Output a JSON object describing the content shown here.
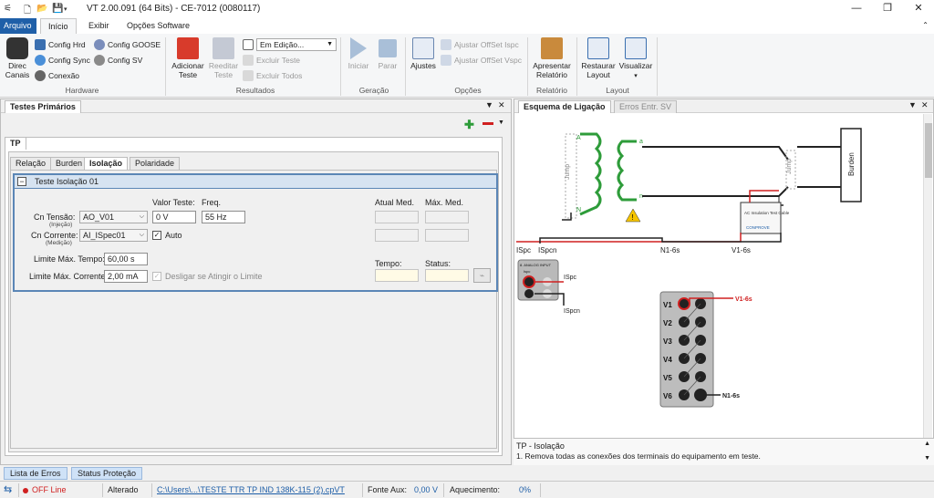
{
  "titlebar": {
    "title": "VT 2.00.091 (64 Bits) - CE-7012 (0080117)"
  },
  "tabs": {
    "file": "Arquivo",
    "inicio": "Início",
    "exibir": "Exibir",
    "opcoes": "Opções Software"
  },
  "ribbon": {
    "direc": "Direc Canais",
    "config_hrd": "Config Hrd",
    "config_sync": "Config Sync",
    "conexao": "Conexão",
    "config_goose": "Config GOOSE",
    "config_sv": "Config SV",
    "adicionar_teste": "Adicionar Teste",
    "reeditar_teste": "Reeditar Teste",
    "em_edicao": "Em Edição...",
    "excluir_teste": "Excluir Teste",
    "excluir_todos": "Excluir Todos",
    "iniciar": "Iniciar",
    "parar": "Parar",
    "ajustes": "Ajustes",
    "ajustar_ispc": "Ajustar OffSet Ispc",
    "ajustar_vspc": "Ajustar OffSet Vspc",
    "apresentar_relatorio": "Apresentar Relatório",
    "restaurar_layout": "Restaurar Layout",
    "visualizar": "Visualizar",
    "groups": {
      "hardware": "Hardware",
      "resultados": "Resultados",
      "geracao": "Geração",
      "opcoes": "Opções",
      "relatorio": "Relatório",
      "layout": "Layout"
    }
  },
  "left_panel": {
    "tab": "Testes Primários",
    "tp_tab": "TP",
    "subtabs": [
      "Relação",
      "Burden",
      "Isolação",
      "Polaridade"
    ],
    "group_title": "Teste Isolação 01",
    "valor_teste_label": "Valor Teste:",
    "freq_label": "Freq.",
    "cn_tensao_label": "Cn Tensão:",
    "cn_tensao_sub": "(Injeção)",
    "cn_tensao_value": "AO_V01",
    "valor_teste_value": "0 V",
    "freq_value": "55 Hz",
    "cn_corrente_label": "Cn Corrente:",
    "cn_corrente_sub": "(Medição)",
    "cn_corrente_value": "AI_ISpec01",
    "auto_label": "Auto",
    "limite_tempo_label": "Limite Máx. Tempo:",
    "limite_tempo_value": "60,00 s",
    "limite_corrente_label": "Limite Máx. Corrente:",
    "limite_corrente_value": "2,00 mA",
    "desligar_label": "Desligar se Atingir o Limite",
    "atual_med_label": "Atual Med.",
    "max_med_label": "Máx. Med.",
    "tempo_label": "Tempo:",
    "status_label": "Status:"
  },
  "right_panel": {
    "tabs": [
      "Esquema de Ligação",
      "Erros Entr. SV"
    ],
    "diagram": {
      "jump_left": "Jump",
      "jump_right": "Jump",
      "burden": "Burden",
      "A": "A",
      "N": "N",
      "a": "a",
      "n": "n",
      "ispc": "ISpc",
      "ispcn": "ISpcn",
      "n1": "N1-6s",
      "v1": "V1-6s",
      "module_title": "8. ANALOG INPUT",
      "module_ispc": "Ispc",
      "insulation_box": "AC Insulation Test Cable",
      "conprove": "CONPROVE",
      "ch_labels": [
        "V1",
        "V2",
        "V3",
        "V4",
        "V5",
        "V6"
      ],
      "v1_tag": "V1-6s",
      "n1_tag": "N1-6s",
      "ispc_tag": "ISpc",
      "ispcn_tag": "ISpcn"
    },
    "footer_title": "TP - Isolação",
    "footer_text": "1. Remova todas as conexões dos terminais do equipamento em teste."
  },
  "bottom_tabs": [
    "Lista de Erros",
    "Status Proteção"
  ],
  "statusbar": {
    "offline": "OFF Line",
    "alterado": "Alterado",
    "path": "C:\\Users\\...\\TESTE TTR TP IND 138K-115 (2).cpVT",
    "fonte_aux_label": "Fonte Aux:",
    "fonte_aux_value": "0,00 V",
    "aquecimento_label": "Aquecimento:",
    "aquecimento_value": "0%"
  },
  "colors": {
    "accent": "#1f5fa8",
    "coil": "#2e9c3a",
    "wire_red": "#d02020"
  }
}
